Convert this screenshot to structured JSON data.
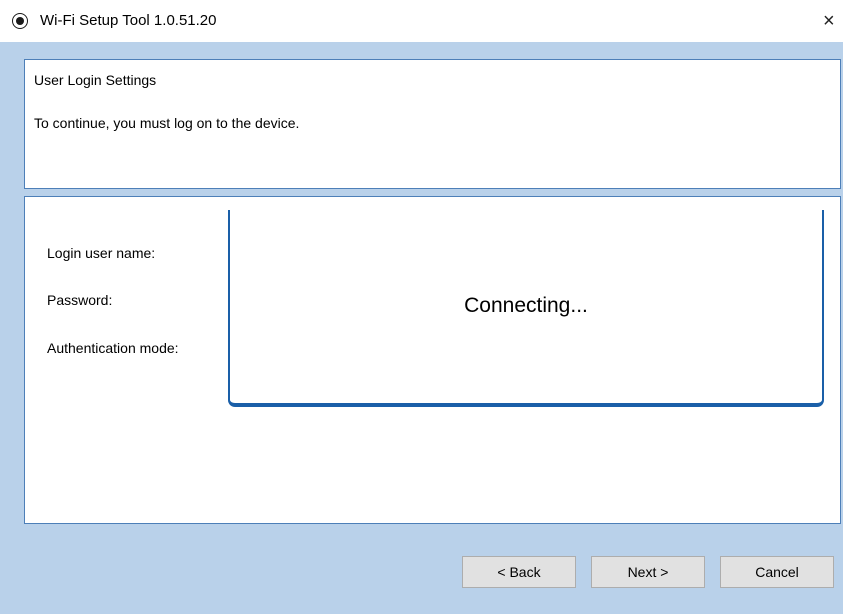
{
  "window": {
    "title": "Wi-Fi Setup Tool 1.0.51.20",
    "close_label": "×"
  },
  "header": {
    "title": "User Login Settings",
    "description": "To continue, you must log on to the device."
  },
  "form": {
    "login_user_name_label": "Login user name:",
    "password_label": "Password:",
    "auth_mode_label": "Authentication mode:"
  },
  "status_dialog": {
    "message": "Connecting..."
  },
  "buttons": {
    "back": "< Back",
    "next": "Next >",
    "cancel": "Cancel"
  },
  "colors": {
    "client_background": "#b9d1ea",
    "panel_border": "#4d7fb8",
    "dialog_accent": "#1a5fa8",
    "button_face": "#e1e1e1"
  },
  "icons": {
    "app": "radio-target-icon",
    "close": "close-icon"
  }
}
